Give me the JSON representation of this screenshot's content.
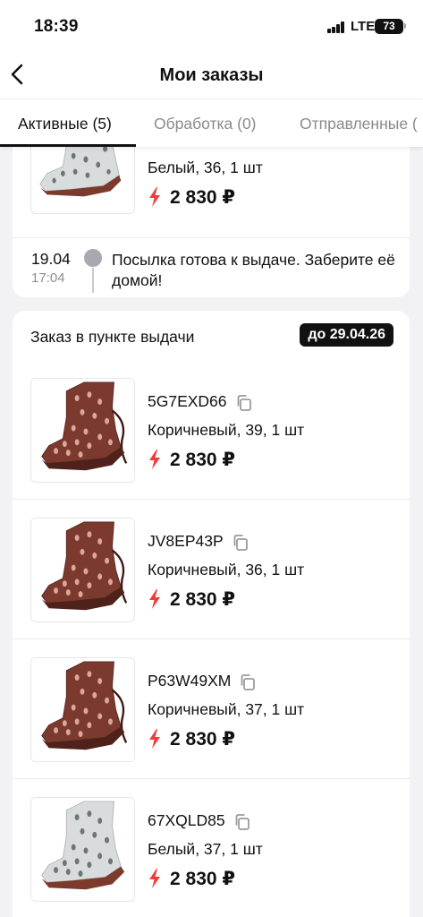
{
  "status_bar": {
    "time": "18:39",
    "network": "LTE",
    "battery": "73"
  },
  "header": {
    "title": "Мои заказы",
    "back_icon": "chevron-left-icon"
  },
  "tabs": [
    {
      "label": "Активные (5)",
      "active": true
    },
    {
      "label": "Обработка (0)",
      "active": false
    },
    {
      "label": "Отправленные (",
      "active": false
    }
  ],
  "order_top": {
    "item": {
      "variant": "Белый, 36, 1 шт",
      "price": "2 830 ₽",
      "color": "white"
    },
    "timeline": {
      "date": "19.04",
      "time": "17:04",
      "message": "Посылка готова к выдаче. Заберите её домой!"
    }
  },
  "order_pickup": {
    "status": "Заказ в пункте выдачи",
    "deadline": "до 29.04.26",
    "items": [
      {
        "sku": "5G7EXD66",
        "variant": "Коричневый, 39, 1 шт",
        "price": "2 830 ₽",
        "color": "brown"
      },
      {
        "sku": "JV8EP43P",
        "variant": "Коричневый, 36, 1 шт",
        "price": "2 830 ₽",
        "color": "brown"
      },
      {
        "sku": "P63W49XM",
        "variant": "Коричневый, 37, 1 шт",
        "price": "2 830 ₽",
        "color": "brown"
      },
      {
        "sku": "67XQLD85",
        "variant": "Белый, 37, 1 шт",
        "price": "2 830 ₽",
        "color": "white"
      }
    ]
  },
  "colors": {
    "accent_price_icon": "#f03c3c",
    "tab_active": "#111111",
    "tab_inactive": "#8a8a8e",
    "badge_bg": "#111111"
  }
}
